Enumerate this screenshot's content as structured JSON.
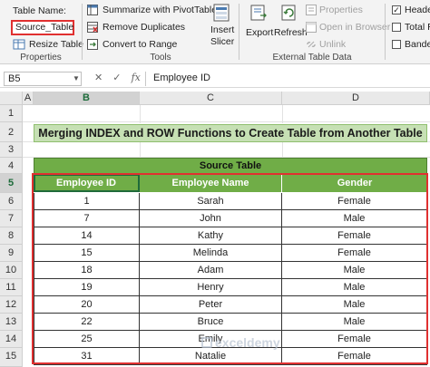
{
  "ribbon": {
    "properties": {
      "table_name_label": "Table Name:",
      "table_name_value": "Source_Table",
      "resize_label": "Resize Table",
      "group_label": "Properties"
    },
    "tools": {
      "summarize_label": "Summarize with PivotTable",
      "remove_dup_label": "Remove Duplicates",
      "convert_label": "Convert to Range",
      "slicer_label_1": "Insert",
      "slicer_label_2": "Slicer",
      "group_label": "Tools"
    },
    "external": {
      "export_label": "Export",
      "refresh_label": "Refresh",
      "properties_label": "Properties",
      "open_browser_label": "Open in Browser",
      "unlink_label": "Unlink",
      "group_label": "External Table Data"
    },
    "style_options": {
      "header_label": "Heade",
      "total_label": "Total R",
      "banded_label": "Bande"
    }
  },
  "formula_bar": {
    "name_box": "B5",
    "fx": "fx",
    "value": "Employee ID"
  },
  "columns": [
    "A",
    "B",
    "C",
    "D"
  ],
  "rows": [
    "1",
    "2",
    "3",
    "4",
    "5",
    "6",
    "7",
    "8",
    "9",
    "10",
    "11",
    "12",
    "13",
    "14",
    "15"
  ],
  "sheet": {
    "title": "Merging INDEX and ROW Functions to Create Table from Another Table",
    "source_title": "Source Table",
    "headers": [
      "Employee ID",
      "Employee Name",
      "Gender"
    ],
    "data": [
      [
        "1",
        "Sarah",
        "Female"
      ],
      [
        "7",
        "John",
        "Male"
      ],
      [
        "14",
        "Kathy",
        "Female"
      ],
      [
        "15",
        "Melinda",
        "Female"
      ],
      [
        "18",
        "Adam",
        "Male"
      ],
      [
        "19",
        "Henry",
        "Male"
      ],
      [
        "20",
        "Peter",
        "Male"
      ],
      [
        "22",
        "Bruce",
        "Male"
      ],
      [
        "25",
        "Emily",
        "Female"
      ],
      [
        "31",
        "Natalie",
        "Female"
      ]
    ]
  },
  "watermark": "exceldemy",
  "colors": {
    "header_green": "#70ad47",
    "title_green": "#c6e0b4",
    "highlight_red": "#e03030"
  }
}
